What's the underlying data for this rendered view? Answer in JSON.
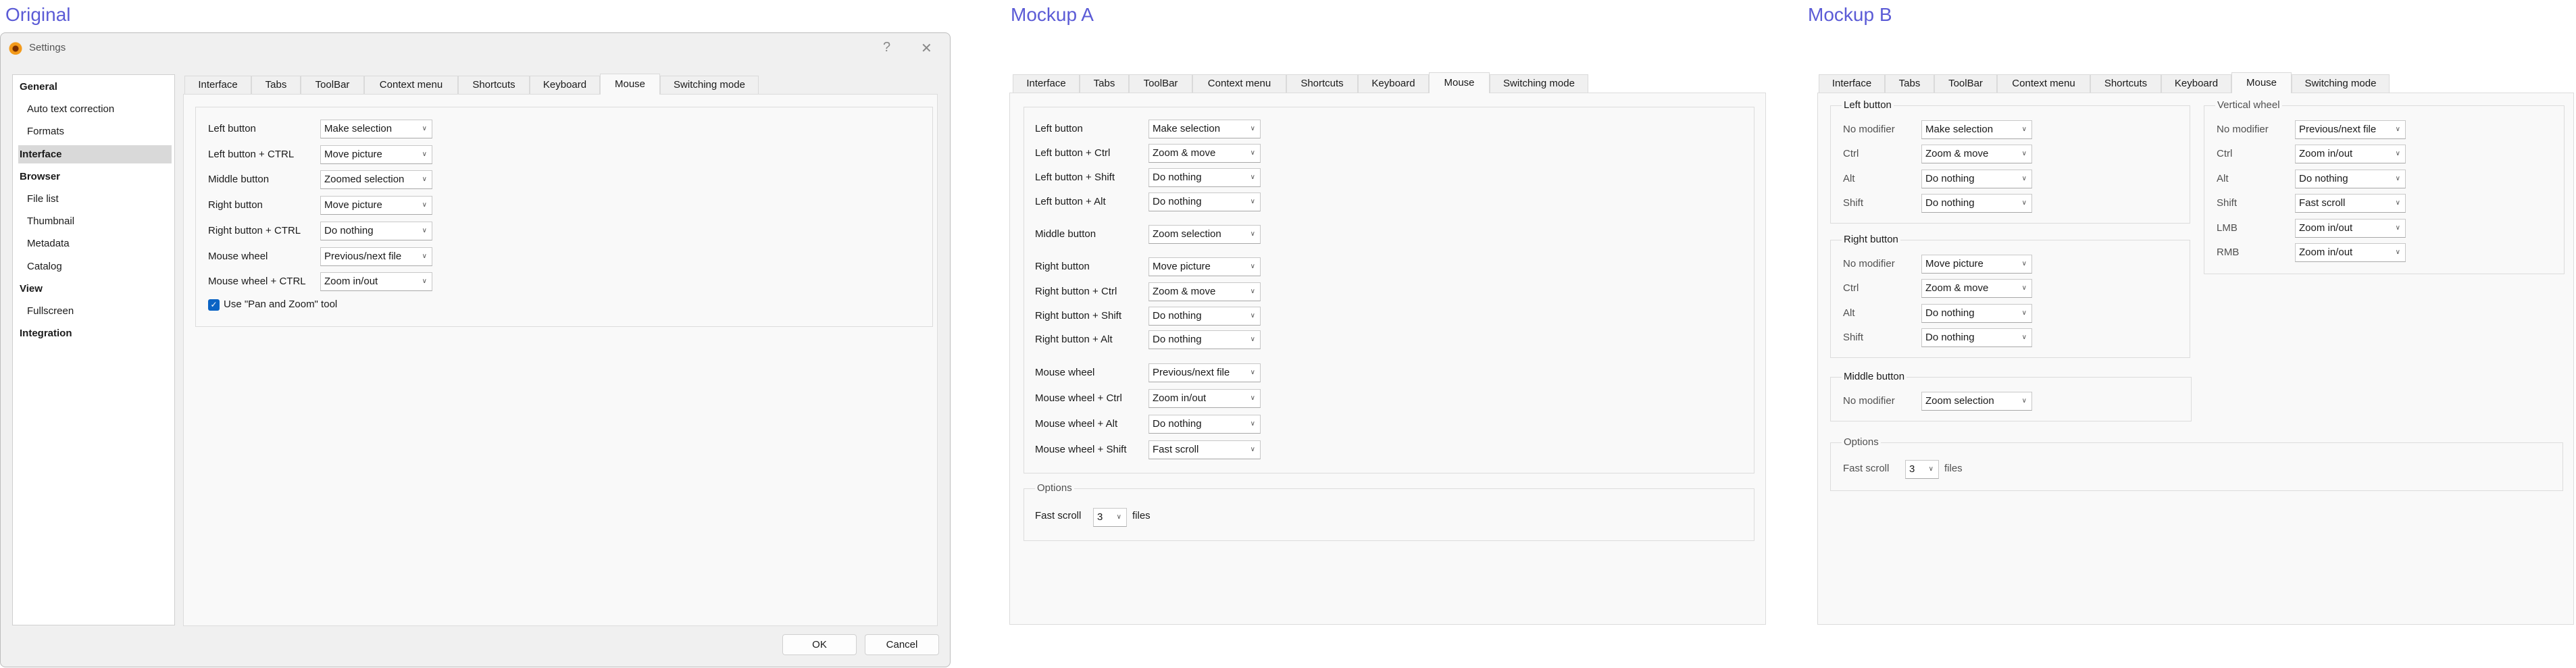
{
  "headings": {
    "original": "Original",
    "mockup_a": "Mockup A",
    "mockup_b": "Mockup B"
  },
  "tabs": [
    "Interface",
    "Tabs",
    "ToolBar",
    "Context menu",
    "Shortcuts",
    "Keyboard",
    "Mouse",
    "Switching mode"
  ],
  "active_tab": "Mouse",
  "original": {
    "title": "Settings",
    "help_label": "?",
    "close_label": "✕",
    "sidebar": [
      {
        "label": "General",
        "type": "bold"
      },
      {
        "label": "Auto text correction",
        "type": "sub"
      },
      {
        "label": "Formats",
        "type": "sub"
      },
      {
        "label": "Interface",
        "type": "bold",
        "selected": true
      },
      {
        "label": "Browser",
        "type": "bold"
      },
      {
        "label": "File list",
        "type": "sub"
      },
      {
        "label": "Thumbnail",
        "type": "sub"
      },
      {
        "label": "Metadata",
        "type": "sub"
      },
      {
        "label": "Catalog",
        "type": "sub"
      },
      {
        "label": "View",
        "type": "bold"
      },
      {
        "label": "Fullscreen",
        "type": "sub"
      },
      {
        "label": "Integration",
        "type": "bold"
      }
    ],
    "rows": [
      {
        "label": "Left button",
        "value": "Make selection"
      },
      {
        "label": "Left button + CTRL",
        "value": "Move picture"
      },
      {
        "label": "Middle button",
        "value": "Zoomed selection"
      },
      {
        "label": "Right button",
        "value": "Move picture"
      },
      {
        "label": "Right button + CTRL",
        "value": "Do nothing"
      },
      {
        "label": "Mouse wheel",
        "value": "Previous/next file"
      },
      {
        "label": "Mouse wheel + CTRL",
        "value": "Zoom in/out"
      }
    ],
    "checkbox": {
      "label": "Use \"Pan and Zoom\" tool",
      "checked": true
    },
    "ok_label": "OK",
    "cancel_label": "Cancel"
  },
  "mockup_a": {
    "rows": [
      {
        "label": "Left button",
        "value": "Make selection"
      },
      {
        "label": "Left button + Ctrl",
        "value": "Zoom & move"
      },
      {
        "label": "Left button + Shift",
        "value": "Do nothing"
      },
      {
        "label": "Left button + Alt",
        "value": "Do nothing"
      },
      {
        "label": "Middle button",
        "value": "Zoom selection"
      },
      {
        "label": "Right button",
        "value": "Move picture"
      },
      {
        "label": "Right button + Ctrl",
        "value": "Zoom & move"
      },
      {
        "label": "Right button + Shift",
        "value": "Do nothing"
      },
      {
        "label": "Right button + Alt",
        "value": "Do nothing"
      },
      {
        "label": "Mouse wheel",
        "value": "Previous/next file"
      },
      {
        "label": "Mouse wheel + Ctrl",
        "value": "Zoom in/out"
      },
      {
        "label": "Mouse wheel + Alt",
        "value": "Do nothing"
      },
      {
        "label": "Mouse wheel + Shift",
        "value": "Fast scroll"
      }
    ],
    "options": {
      "legend": "Options",
      "label": "Fast scroll",
      "value": "3",
      "suffix": "files"
    }
  },
  "mockup_b": {
    "groups": [
      {
        "legend": "Left button",
        "rows": [
          {
            "label": "No modifier",
            "value": "Make selection"
          },
          {
            "label": "Ctrl",
            "value": "Zoom & move"
          },
          {
            "label": "Alt",
            "value": "Do nothing"
          },
          {
            "label": "Shift",
            "value": "Do nothing"
          }
        ]
      },
      {
        "legend": "Right button",
        "rows": [
          {
            "label": "No modifier",
            "value": "Move picture"
          },
          {
            "label": "Ctrl",
            "value": "Zoom & move"
          },
          {
            "label": "Alt",
            "value": "Do nothing"
          },
          {
            "label": "Shift",
            "value": "Do nothing"
          }
        ]
      },
      {
        "legend": "Middle button",
        "rows": [
          {
            "label": "No modifier",
            "value": "Zoom selection"
          }
        ]
      },
      {
        "legend": "Vertical wheel",
        "rows": [
          {
            "label": "No modifier",
            "value": "Previous/next file"
          },
          {
            "label": "Ctrl",
            "value": "Zoom in/out"
          },
          {
            "label": "Alt",
            "value": "Do nothing"
          },
          {
            "label": "Shift",
            "value": "Fast scroll"
          },
          {
            "label": "LMB",
            "value": "Zoom in/out"
          },
          {
            "label": "RMB",
            "value": "Zoom in/out"
          }
        ]
      }
    ],
    "options": {
      "legend": "Options",
      "label": "Fast scroll",
      "value": "3",
      "suffix": "files"
    }
  },
  "icons": {
    "dropdown": "chevron-down-icon",
    "check": "checkmark-icon",
    "app": "app-logo-icon"
  },
  "colors": {
    "heading": "#5b5bd6",
    "checkbox": "#0b63c4",
    "selected_item": "#d9d9d9"
  }
}
